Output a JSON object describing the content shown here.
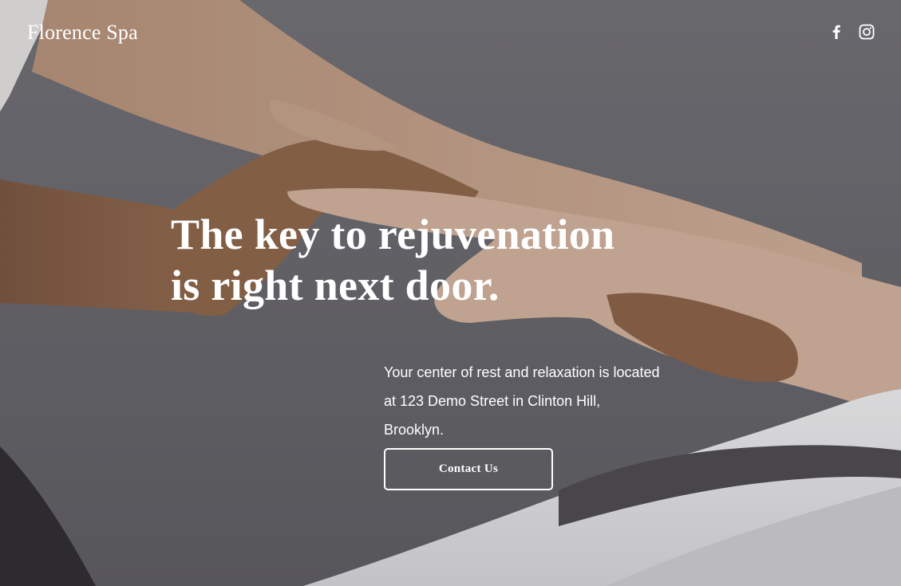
{
  "brand": {
    "name": "Florence Spa"
  },
  "social": {
    "links": [
      {
        "icon": "facebook-icon",
        "label": "Facebook"
      },
      {
        "icon": "instagram-icon",
        "label": "Instagram"
      }
    ]
  },
  "hero": {
    "headline_lines": [
      "The key to rejuvenation",
      "is right next door."
    ],
    "intro_lines": [
      "Your center of rest and relaxation is located",
      "at 123 Demo Street in Clinton Hill,",
      "Brooklyn."
    ],
    "cta_label": "Contact Us",
    "background_image": "hands-massage-photo"
  },
  "colors": {
    "text": "#ffffff",
    "background": "#6b6a70",
    "skin_light": "#c9a68e",
    "skin_dark": "#8a6248",
    "towel": "#e9e9ec"
  }
}
